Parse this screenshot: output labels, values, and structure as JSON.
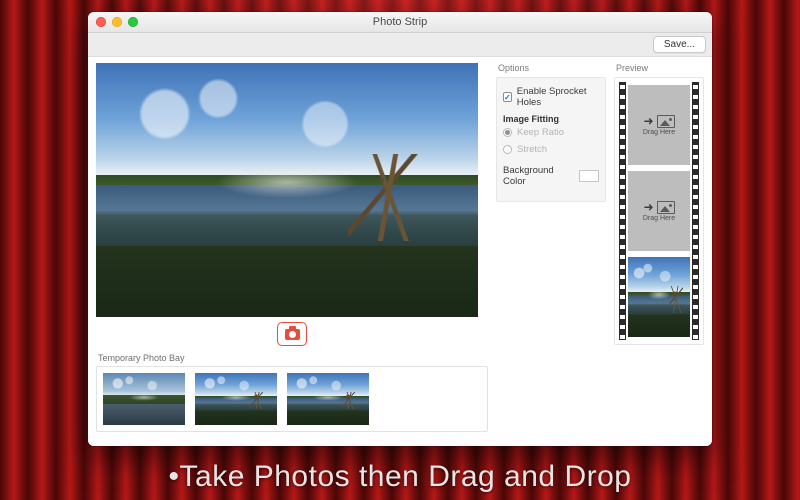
{
  "window": {
    "title": "Photo Strip"
  },
  "toolbar": {
    "save_label": "Save..."
  },
  "options": {
    "panel_title": "Options",
    "enable_sprocket_label": "Enable Sprocket Holes",
    "enable_sprocket_checked": true,
    "image_fitting_label": "Image Fitting",
    "keep_ratio_label": "Keep Ratio",
    "stretch_label": "Stretch",
    "fitting_selected": "keep_ratio",
    "background_color_label": "Background Color",
    "background_color_value": "#FFFFFF"
  },
  "preview": {
    "panel_title": "Preview",
    "frames": [
      {
        "type": "placeholder",
        "label": "Drag Here"
      },
      {
        "type": "placeholder",
        "label": "Drag Here"
      },
      {
        "type": "photo"
      }
    ]
  },
  "photo_bay": {
    "label": "Temporary Photo Bay",
    "thumbs": [
      {
        "variant": "alt"
      },
      {
        "variant": "main"
      },
      {
        "variant": "main"
      }
    ]
  },
  "caption": "•Take Photos then Drag and Drop"
}
